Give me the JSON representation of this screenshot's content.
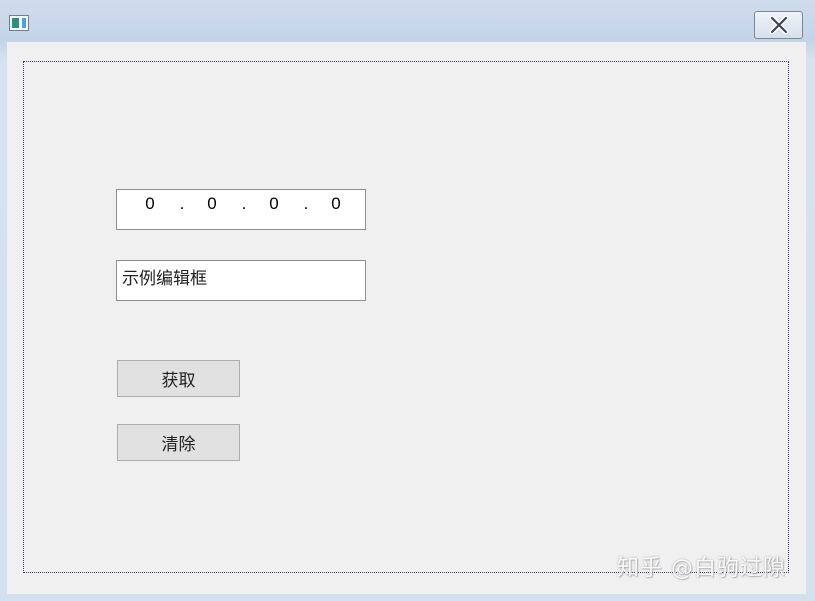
{
  "window": {
    "close_icon": "close-x-icon",
    "app_icon": "app-window-icon"
  },
  "ip_address": {
    "octets": [
      "0",
      "0",
      "0",
      "0"
    ],
    "separator": "."
  },
  "edit_box": {
    "value": "示例编辑框"
  },
  "buttons": {
    "get_label": "获取",
    "clear_label": "清除"
  },
  "watermark": {
    "text": "知乎 @白驹过隙"
  }
}
